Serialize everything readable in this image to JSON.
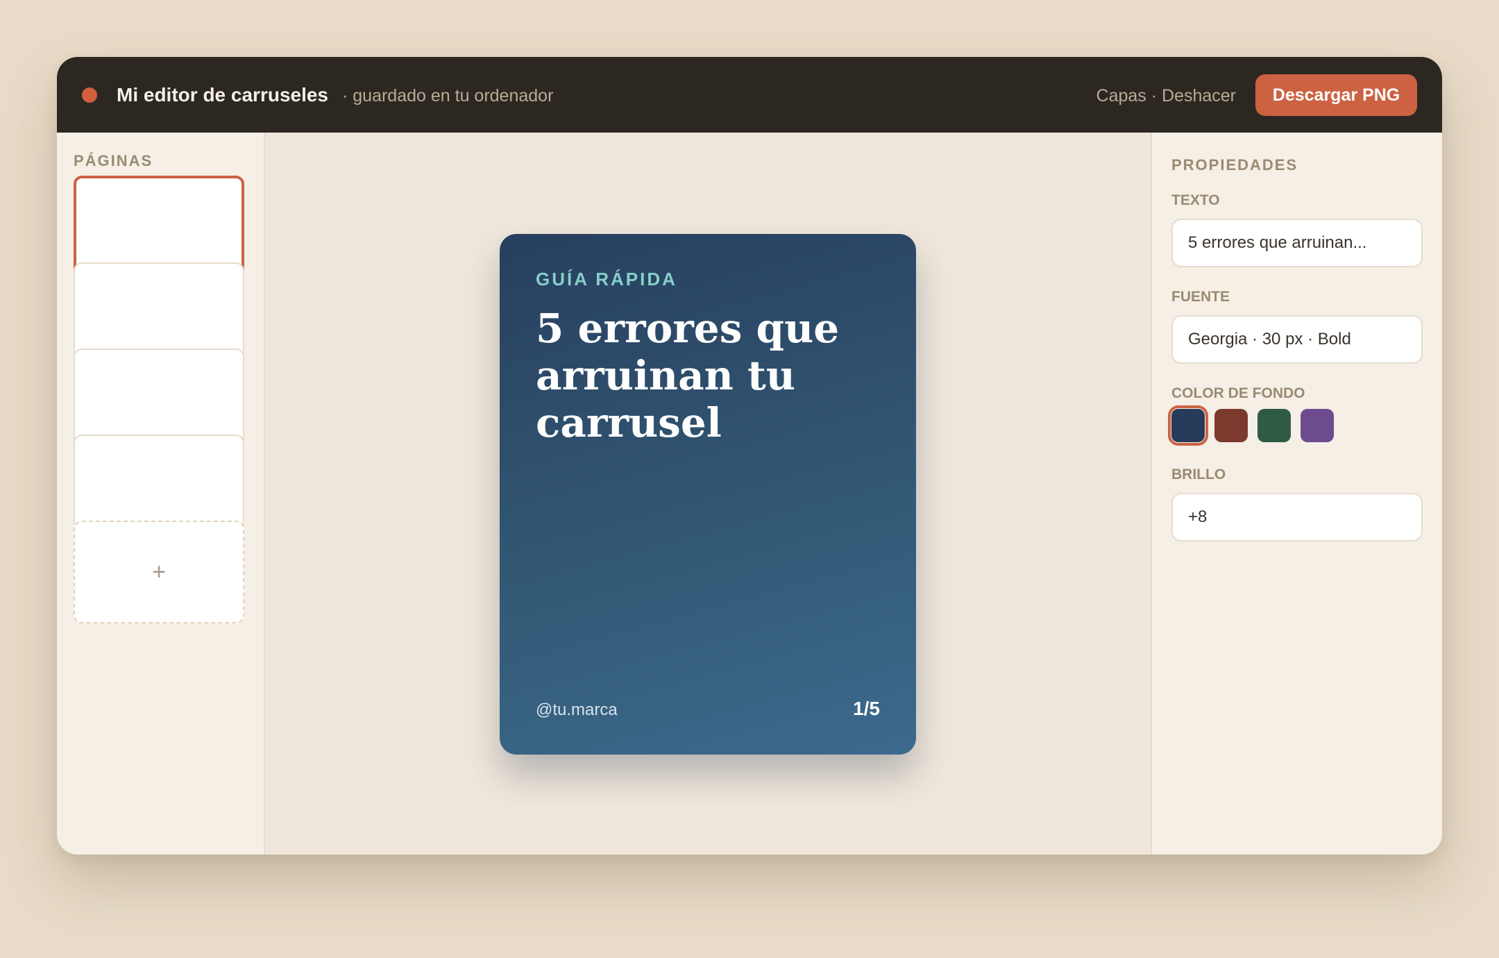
{
  "topbar": {
    "title": "Mi editor de carruseles",
    "subtitle": "· guardado en tu ordenador",
    "actions": "Capas · Deshacer",
    "download_label": "Descargar PNG"
  },
  "sidebar": {
    "heading": "PÁGINAS",
    "pages": [
      {
        "name": "page-1",
        "active": true
      },
      {
        "name": "page-2",
        "active": false
      },
      {
        "name": "page-3",
        "active": false
      },
      {
        "name": "page-4",
        "active": false
      }
    ],
    "add_label": "+"
  },
  "slide": {
    "kicker": "GUÍA RÁPIDA",
    "title": "5 errores que arruinan tu carrusel",
    "handle": "@tu.marca",
    "pager": "1/5"
  },
  "properties": {
    "heading": "PROPIEDADES",
    "text_label": "TEXTO",
    "text_value": "5 errores que arruinan...",
    "font_label": "FUENTE",
    "font_value": "Georgia · 30 px · Bold",
    "bg_label": "COLOR DE FONDO",
    "swatches": [
      {
        "color": "#263a59",
        "selected": true
      },
      {
        "color": "#7c3a2f",
        "selected": false
      },
      {
        "color": "#2f5b45",
        "selected": false
      },
      {
        "color": "#6d4b8e",
        "selected": false
      }
    ],
    "brightness_label": "BRILLO",
    "brightness_value": "+8"
  },
  "colors": {
    "accent": "#cc6242",
    "topbar": "#2c2821",
    "kicker": "#86cfc9"
  }
}
